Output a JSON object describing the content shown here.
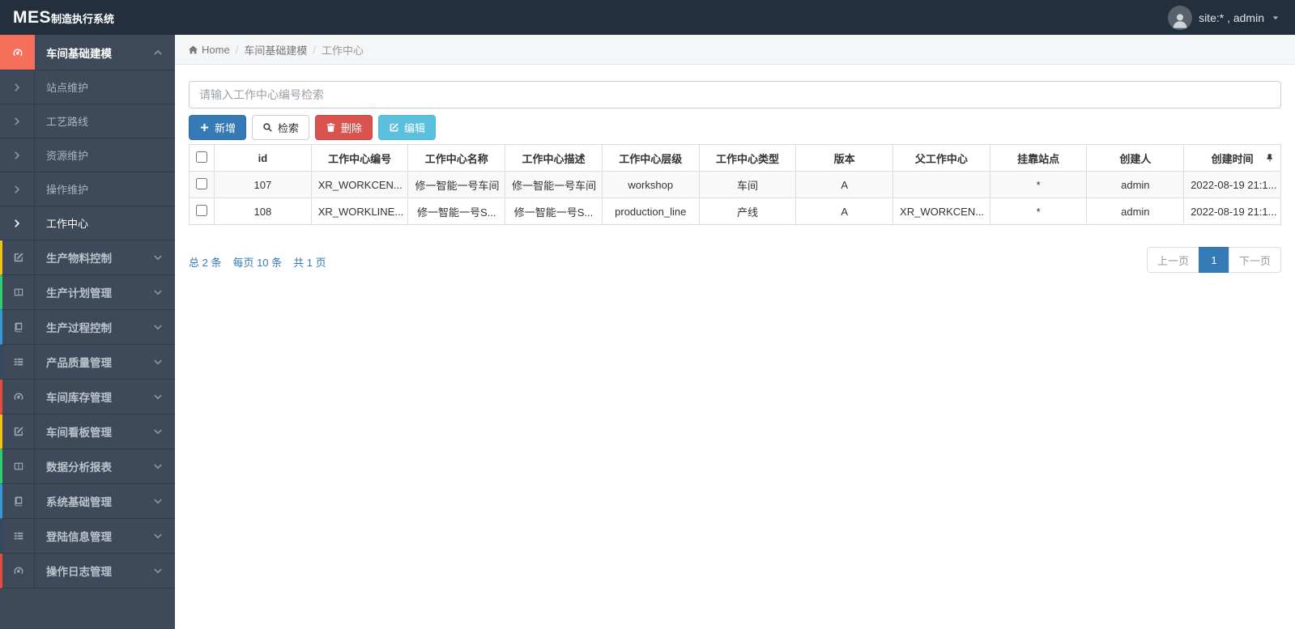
{
  "navbar": {
    "logo_bold": "MES",
    "logo_rest": "制造执行系统",
    "user_label": "site:* , admin"
  },
  "sidebar": {
    "active_group": {
      "label": "车间基础建模",
      "icon": "dashboard-icon"
    },
    "submenu": [
      {
        "label": "站点维护",
        "active": false
      },
      {
        "label": "工艺路线",
        "active": false
      },
      {
        "label": "资源维护",
        "active": false
      },
      {
        "label": "操作维护",
        "active": false
      },
      {
        "label": "工作中心",
        "active": true
      }
    ],
    "groups": [
      {
        "label": "生产物料控制",
        "icon": "pencil-square-icon",
        "accent": "#f1c40f"
      },
      {
        "label": "生产计划管理",
        "icon": "columns-icon",
        "accent": "#2ecc71"
      },
      {
        "label": "生产过程控制",
        "icon": "book-icon",
        "accent": "#3498db"
      },
      {
        "label": "产品质量管理",
        "icon": "th-list-icon",
        "accent": "#34495e"
      },
      {
        "label": "车间库存管理",
        "icon": "dashboard-icon",
        "accent": "#e74c3c"
      },
      {
        "label": "车间看板管理",
        "icon": "pencil-square-icon",
        "accent": "#f1c40f"
      },
      {
        "label": "数据分析报表",
        "icon": "columns-icon",
        "accent": "#2ecc71"
      },
      {
        "label": "系统基础管理",
        "icon": "book-icon",
        "accent": "#3498db"
      },
      {
        "label": "登陆信息管理",
        "icon": "th-list-icon",
        "accent": "#34495e"
      },
      {
        "label": "操作日志管理",
        "icon": "dashboard-icon",
        "accent": "#e74c3c"
      }
    ]
  },
  "breadcrumb": {
    "home": "Home",
    "section": "车间基础建模",
    "current": "工作中心"
  },
  "search": {
    "placeholder": "请输入工作中心编号检索"
  },
  "toolbar": {
    "add_label": "新增",
    "search_label": "检索",
    "delete_label": "删除",
    "edit_label": "编辑"
  },
  "table": {
    "headers": [
      "id",
      "工作中心编号",
      "工作中心名称",
      "工作中心描述",
      "工作中心层级",
      "工作中心类型",
      "版本",
      "父工作中心",
      "挂靠站点",
      "创建人",
      "创建时间"
    ],
    "rows": [
      [
        "107",
        "XR_WORKCEN...",
        "修一智能一号车间",
        "修一智能一号车间",
        "workshop",
        "车间",
        "A",
        "",
        "*",
        "admin",
        "2022-08-19 21:1..."
      ],
      [
        "108",
        "XR_WORKLINE...",
        "修一智能一号S...",
        "修一智能一号S...",
        "production_line",
        "产线",
        "A",
        "XR_WORKCEN...",
        "*",
        "admin",
        "2022-08-19 21:1..."
      ]
    ]
  },
  "pagination": {
    "summary_total": "总 2 条",
    "summary_perpage": "每页 10 条",
    "summary_pages": "共 1 页",
    "prev_label": "上一页",
    "page_label": "1",
    "next_label": "下一页"
  },
  "colors": {
    "navbar_bg": "#242f3e",
    "sidebar_bg": "#3e4a59",
    "active_icon_bg": "#f4705b",
    "primary": "#337ab7",
    "danger": "#d9534f",
    "info": "#5bc0de",
    "link": "#337ab7"
  },
  "icons": {
    "dashboard-icon": "gauge",
    "pencil-square-icon": "pencil-in-square",
    "columns-icon": "two-columns",
    "book-icon": "book",
    "th-list-icon": "list-rows",
    "home-icon": "house",
    "plus-icon": "plus",
    "search-icon": "magnifier",
    "trash-icon": "trash-can",
    "edit-icon": "pencil-in-square",
    "pin-icon": "thumbtack",
    "caret-down-icon": "triangle-down",
    "chevron-right-icon": ">",
    "chevron-down-icon": "v",
    "chevron-up-icon": "^"
  }
}
